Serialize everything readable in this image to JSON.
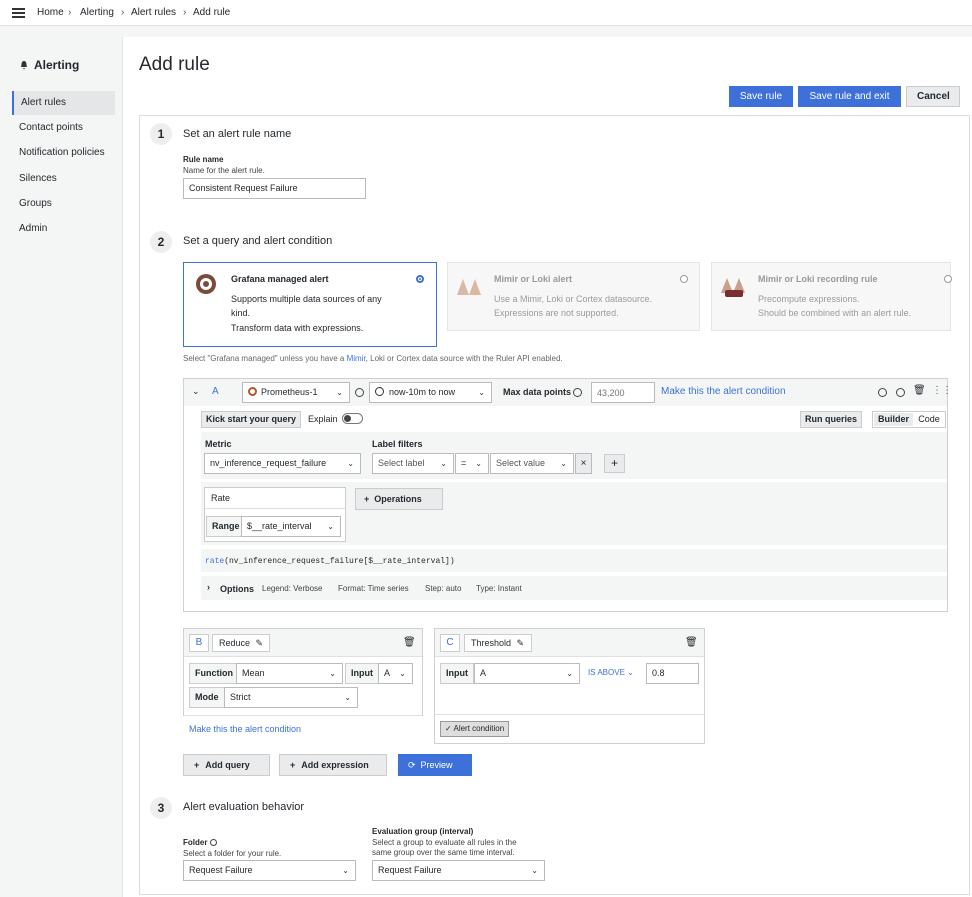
{
  "breadcrumb": [
    "Home",
    "Alerting",
    "Alert rules",
    "Add rule"
  ],
  "sidebar": {
    "title": "Alerting",
    "items": [
      {
        "label": "Alert rules",
        "active": true
      },
      {
        "label": "Contact points"
      },
      {
        "label": "Notification policies"
      },
      {
        "label": "Silences"
      },
      {
        "label": "Groups"
      },
      {
        "label": "Admin"
      }
    ]
  },
  "page": {
    "title": "Add rule",
    "save_label": "Save rule",
    "save_exit_label": "Save rule and exit",
    "cancel_label": "Cancel"
  },
  "step1": {
    "num": "1",
    "title": "Set an alert rule name",
    "field_label": "Rule name",
    "field_desc": "Name for the alert rule.",
    "value": "Consistent Request Failure"
  },
  "step2": {
    "num": "2",
    "title": "Set a query and alert condition",
    "cards": [
      {
        "title": "Grafana managed alert",
        "desc1": "Supports multiple data sources of any",
        "desc2": "kind.",
        "desc3": "Transform data with expressions."
      },
      {
        "title": "Mimir or Loki alert",
        "desc1": "Use a Mimir, Loki or Cortex datasource.",
        "desc2": "Expressions are not supported."
      },
      {
        "title": "Mimir or Loki recording rule",
        "desc1": "Precompute expressions.",
        "desc2": "Should be combined with an alert rule."
      }
    ],
    "hint_pre": "Select \"Grafana managed\" unless you have a ",
    "hint_mid": "Mimir",
    "hint_post": ", Loki or Cortex data source with the Ruler API enabled."
  },
  "query": {
    "ref": "A",
    "datasource": "Prometheus-1",
    "timerange": "now-10m to now",
    "max_points_label": "Max data points",
    "max_points_placeholder": "43,200",
    "make_condition": "Make this the alert condition",
    "kick_start": "Kick start your query",
    "explain": "Explain",
    "run_queries": "Run queries",
    "builder": "Builder",
    "code": "Code",
    "metric_label": "Metric",
    "metric_value": "nv_inference_request_failure",
    "labelfilters_label": "Label filters",
    "select_label": "Select label",
    "operator": "=",
    "select_value": "Select value",
    "rate_label": "Rate",
    "range_label": "Range",
    "range_value": "$__rate_interval",
    "operations_label": "Operations",
    "code_text": "rate(nv_inference_request_failure[$__rate_interval])",
    "code_fn": "rate",
    "code_rest": "(nv_inference_request_failure[$__rate_interval])",
    "options_label": "Options",
    "opt_legend": "Legend: Verbose",
    "opt_format": "Format: Time series",
    "opt_step": "Step: auto",
    "opt_type": "Type: Instant"
  },
  "expr_b": {
    "ref": "B",
    "name": "Reduce",
    "function_label": "Function",
    "function_value": "Mean",
    "input_label": "Input",
    "input_value": "A",
    "mode_label": "Mode",
    "mode_value": "Strict",
    "make_condition": "Make this the alert condition"
  },
  "expr_c": {
    "ref": "C",
    "name": "Threshold",
    "input_label": "Input",
    "input_value": "A",
    "operator": "IS ABOVE",
    "threshold": "0.8",
    "alert_condition": "Alert condition"
  },
  "actions": {
    "add_query": "Add query",
    "add_expression": "Add expression",
    "preview": "Preview"
  },
  "step3": {
    "num": "3",
    "title": "Alert evaluation behavior",
    "folder_label": "Folder",
    "folder_desc": "Select a folder for your rule.",
    "folder_value": "Request Failure",
    "group_label": "Evaluation group (interval)",
    "group_desc1": "Select a group to evaluate all rules in the",
    "group_desc2": "same group over the same time interval.",
    "group_value": "Request Failure"
  },
  "colors": {
    "primary": "#3d71d9"
  }
}
